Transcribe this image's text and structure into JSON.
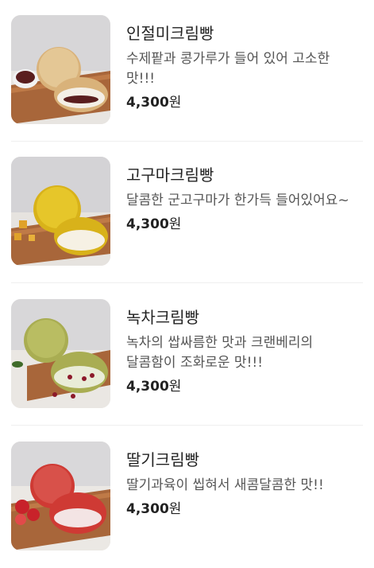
{
  "items": [
    {
      "name": "인절미크림빵",
      "desc": "수제팥과 콩가루가 들어 있어 고소한 맛!!!",
      "price": "4,300",
      "unit": "원",
      "image_icon": "injeolmi-cream-bread-photo",
      "colors": {
        "bun": "#d9b27a",
        "crumb": "#e4c795",
        "filling": "#f4efe6",
        "accent": "#5a1e1e"
      }
    },
    {
      "name": "고구마크림빵",
      "desc": "달콤한 군고구마가 한가득 들어있어요~",
      "price": "4,300",
      "unit": "원",
      "image_icon": "sweet-potato-cream-bread-photo",
      "colors": {
        "bun": "#d8b21a",
        "crumb": "#e6c62a",
        "filling": "#f6f1e4",
        "accent": "#e0a22a"
      }
    },
    {
      "name": "녹차크림빵",
      "desc": "녹차의 쌉싸름한 맛과 크랜베리의 달콤함이 조화로운 맛!!!",
      "price": "4,300",
      "unit": "원",
      "image_icon": "green-tea-cream-bread-photo",
      "colors": {
        "bun": "#a9ad52",
        "crumb": "#b9bd62",
        "filling": "#e9ecd7",
        "accent": "#8c1a2a"
      }
    },
    {
      "name": "딸기크림빵",
      "desc": "딸기과육이 씹혀서 새콤달콤한 맛!!",
      "price": "4,300",
      "unit": "원",
      "image_icon": "strawberry-cream-bread-photo",
      "colors": {
        "bun": "#cf3a34",
        "crumb": "#d8514a",
        "filling": "#f3e4e4",
        "accent": "#c8222a"
      }
    }
  ]
}
